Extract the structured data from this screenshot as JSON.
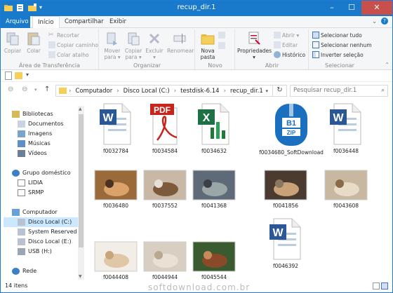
{
  "window": {
    "title": "recup_dir.1"
  },
  "tabs": [
    {
      "label": "Arquivo"
    },
    {
      "label": "Início"
    },
    {
      "label": "Compartilhar"
    },
    {
      "label": "Exibir"
    }
  ],
  "ribbon": {
    "clipboard": {
      "group": "Área de Transferência",
      "copy": "Copiar",
      "paste": "Colar",
      "cut": "Recortar",
      "copy_path": "Copiar caminho",
      "paste_shortcut": "Colar atalho"
    },
    "organize": {
      "group": "Organizar",
      "move_to": "Mover para ▾",
      "copy_to": "Copiar para ▾",
      "delete": "Excluir ▾",
      "rename": "Renomear"
    },
    "new": {
      "group": "Novo",
      "new_folder": "Nova pasta"
    },
    "open": {
      "group": "Abrir",
      "properties": "Propriedades ▾",
      "open": "Abrir ▾",
      "edit": "Editar",
      "history": "Histórico"
    },
    "select": {
      "group": "Selecionar",
      "select_all": "Selecionar tudo",
      "select_none": "Selecionar nenhum",
      "invert": "Inverter seleção"
    }
  },
  "address": {
    "segments": [
      "Computador",
      "Disco Local (C:)",
      "testdisk-6.14",
      "recup_dir.1"
    ],
    "search_placeholder": "Pesquisar recup_dir.1"
  },
  "nav": {
    "libraries": "Bibliotecas",
    "documents": "Documentos",
    "images": "Imagens",
    "music": "Músicas",
    "videos": "Vídeos",
    "homegroup": "Grupo doméstico",
    "user1": "LIDIA",
    "user2": "SRMP",
    "computer": "Computador",
    "disk_c": "Disco Local (C:)",
    "sysres": "System Reserved (D",
    "disk_e": "Disco Local (E:)",
    "usb": "USB (H:)",
    "network": "Rede"
  },
  "files": [
    {
      "name": "f0032784",
      "kind": "word"
    },
    {
      "name": "f0034584",
      "kind": "pdf"
    },
    {
      "name": "f0034632",
      "kind": "excel"
    },
    {
      "name": "f0034680_SoftDownload",
      "kind": "zip",
      "zip_top": "B1",
      "zip_bottom": "ZIP"
    },
    {
      "name": "f0036448",
      "kind": "word"
    },
    {
      "name": "f0036480",
      "kind": "photo"
    },
    {
      "name": "f0037552",
      "kind": "photo"
    },
    {
      "name": "f0041368",
      "kind": "photo"
    },
    {
      "name": "f0041856",
      "kind": "photo"
    },
    {
      "name": "f0043608",
      "kind": "photo"
    },
    {
      "name": "f0044408",
      "kind": "photo"
    },
    {
      "name": "f0044944",
      "kind": "photo"
    },
    {
      "name": "f0045544",
      "kind": "photo"
    },
    {
      "name": "f0046392",
      "kind": "word"
    }
  ],
  "pdf_badge": "PDF",
  "status": {
    "count": "14 itens"
  },
  "watermark": "softdownload.com.br"
}
